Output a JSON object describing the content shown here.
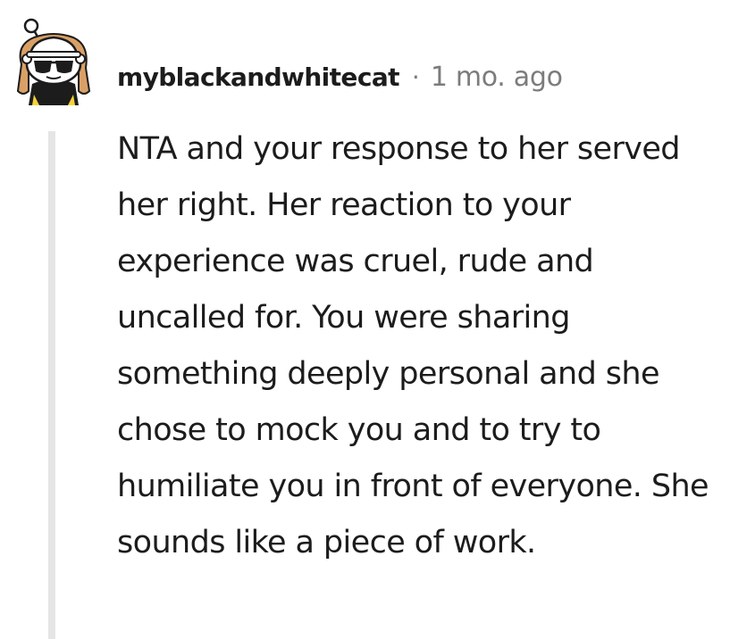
{
  "comment": {
    "username": "myblackandwhitecat",
    "separator": "·",
    "timestamp": "1 mo. ago",
    "avatar_icon": "snoo-avatar-icon",
    "body": "NTA and your response to her served her right. Her reaction to your experience was cruel, rude and uncalled for. You were sharing something deeply personal and she chose to mock you and to try to humiliate you in front of everyone. She sounds like a piece of work."
  },
  "colors": {
    "text": "#1c1c1c",
    "meta": "#7c7c7c",
    "thread_line": "#e5e5e5",
    "avatar_hair": "#d9a066",
    "avatar_shirt": "#1c1c1c",
    "avatar_accent": "#f6d23a"
  }
}
